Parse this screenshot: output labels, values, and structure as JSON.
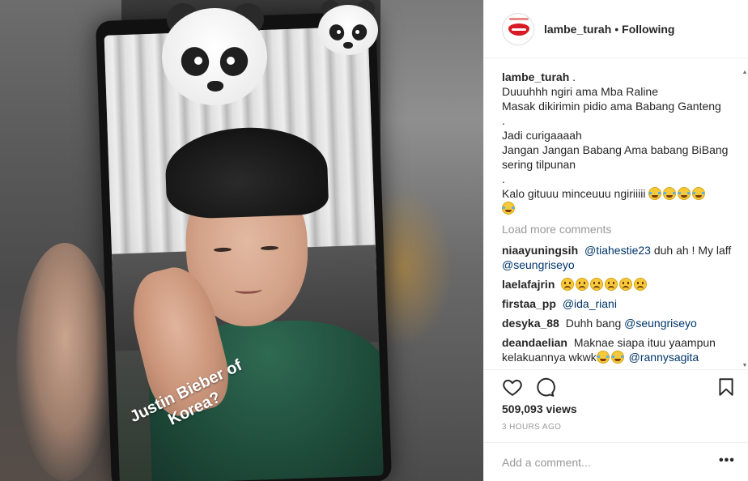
{
  "post": {
    "username": "lambe_turah",
    "separator": "•",
    "follow_status": "Following"
  },
  "media": {
    "caption_line1": "Justin Bieber of",
    "caption_line2": "Korea?"
  },
  "caption": {
    "username": "lambe_turah",
    "lead": ".",
    "lines": [
      "Duuuhhh ngiri ama Mba Raline",
      "Masak dikirimin pidio ama Babang Ganteng",
      ".",
      "Jadi curigaaaah",
      "Jangan Jangan Babang Ama babang BiBang",
      "sering tilpunan",
      ".",
      "Kalo gituuu minceuuu ngiriiiii"
    ]
  },
  "load_more": "Load more comments",
  "comments": [
    {
      "user": "niaayuningsih",
      "mention1": "@tiahestie23",
      "text": "duh ah ! My",
      "text2": "laff",
      "mention2": "@seungriseyo"
    },
    {
      "user": "laelafajrin"
    },
    {
      "user": "firstaa_pp",
      "mention1": "@ida_riani"
    },
    {
      "user": "desyka_88",
      "text": "Duhh bang",
      "mention1": "@seungriseyo"
    },
    {
      "user": "deandaelian",
      "text": "Maknae siapa ituu yaampun",
      "text2": "kelakuannya wkwk",
      "mention1": "@rannysagita"
    }
  ],
  "icons": {
    "like": "heart-icon",
    "comment": "comment-icon",
    "save": "bookmark-icon",
    "more": "more-options-icon"
  },
  "stats": {
    "views": "509,093 views",
    "time": "3 HOURS AGO"
  },
  "add_comment": {
    "placeholder": "Add a comment...",
    "more_label": "•••"
  },
  "colors": {
    "text": "#262626",
    "muted": "#999999",
    "mention": "#003569",
    "border": "#efefef",
    "brand_lips": "#d81b24"
  }
}
